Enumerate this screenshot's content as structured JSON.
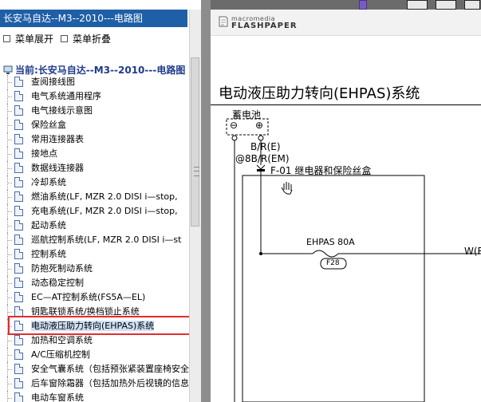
{
  "left_pane": {
    "title": "长安马自达--M3--2010---电路图",
    "expand_label": "菜单展开",
    "collapse_label": "菜单折叠",
    "root_label": "当前:长安马自达--M3--2010---电路图",
    "items": [
      "查阅接线图",
      "电气系统通用程序",
      "电气接线示意图",
      "保险丝盒",
      "常用连接器表",
      "接地点",
      "数据线连接器",
      "冷却系统",
      "燃油系统(LF, MZR 2.0 DISI i—stop,",
      "充电系统(LF, MZR 2.0 DISI i—stop,",
      "起动系统",
      "巡航控制系统(LF, MZR 2.0 DISI i—st",
      "控制系统",
      "防抱死制动系统",
      "动态稳定控制",
      "EC—AT控制系统(FS5A—EL)",
      "钥匙联锁系统/换档锁止系统",
      "电动液压助力转向(EHPAS)系统",
      "加热和空调系统",
      "A/C压缩机控制",
      "安全气囊系统（包括预张紧装置座椅安全",
      "后车窗除霜器（包括加热外后视镜的信息",
      "电动车窗系统"
    ],
    "selected_index": 17,
    "scroll_position": 0.25
  },
  "flashpaper": {
    "brand_top": "macromedia",
    "brand_bottom": "FLASHPAPER"
  },
  "document": {
    "title": "电动液压助力转向(EHPAS)系统",
    "battery_label": "蓄电池",
    "minus": "⊖",
    "plus": "⊕",
    "wire1": "B/R(E)",
    "wire2": "@8B/R(EM)",
    "box_label": "F-01  继电器和保险丝盒",
    "fuse_label": "EHPAS 80A",
    "fuse_id": "F28",
    "right_wire": "W(R"
  }
}
